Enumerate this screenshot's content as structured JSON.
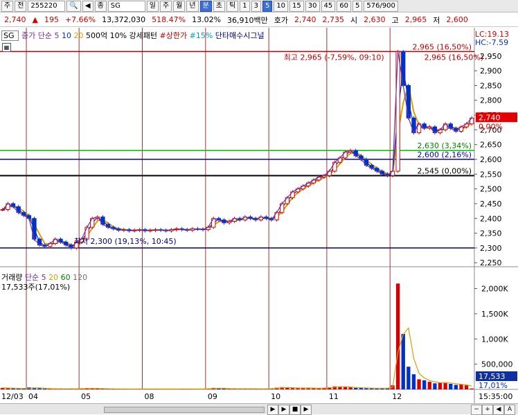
{
  "toolbar": {
    "items": [
      "주",
      "전",
      "255220",
      "🔍",
      "◀",
      "종",
      "SG",
      "일",
      "주",
      "월",
      "년",
      "분",
      "초",
      "틱",
      "1",
      "3",
      "5",
      "10",
      "15",
      "30",
      "45",
      "60",
      "5",
      "576/900"
    ]
  },
  "quote": {
    "price": "2,740",
    "arrow": "▲",
    "change": "195",
    "change_pct": "+7.66%",
    "volume": "13,372,030",
    "vol_ratio": "518.47%",
    "turnover": "13.02%",
    "amount": "36,910백만",
    "label_ask": "호가",
    "ask1": "2,740",
    "ask2": "2,735",
    "label_open": "시",
    "open": "2,630",
    "label_high": "고",
    "high": "2,965",
    "label_low": "저",
    "low": "2,600"
  },
  "price_legend": {
    "tag": "SG",
    "items": [
      {
        "text": "종가 단순",
        "color": "#7030a0"
      },
      {
        "text": "5",
        "color": "#7030a0"
      },
      {
        "text": "10",
        "color": "#0030c8"
      },
      {
        "text": "20",
        "color": "#d8a000"
      },
      {
        "text": "500억 10% 강세패턴",
        "color": "#000000"
      },
      {
        "text": "#상한가",
        "color": "#c00000"
      },
      {
        "text": "#15%",
        "color": "#00a0c0"
      },
      {
        "text": "단타매수시그널",
        "color": "#000080"
      }
    ]
  },
  "volume_legend": {
    "items": [
      {
        "text": "거래량",
        "color": "#000000"
      },
      {
        "text": "단순",
        "color": "#7030a0"
      },
      {
        "text": "5",
        "color": "#7030a0"
      },
      {
        "text": "20",
        "color": "#d8a000"
      },
      {
        "text": "60",
        "color": "#008000"
      },
      {
        "text": "120",
        "color": "#707070"
      }
    ],
    "current": "17,533주(17,01%)"
  },
  "corner": {
    "lc": "LC:19.13",
    "hc": "HC:-7.59"
  },
  "chart_data": {
    "type": "candlestick",
    "price_axis": {
      "ylim": [
        2220,
        2980
      ],
      "ticks": [
        2250,
        2300,
        2350,
        2400,
        2450,
        2500,
        2550,
        2600,
        2650,
        2700,
        2750,
        2800,
        2850,
        2900,
        2950
      ],
      "tick_labels": [
        "2,250",
        "2,300",
        "2,350",
        "2,400",
        "2,450",
        "2,500",
        "2,550",
        "2,600",
        "2,650",
        "2,700",
        "2,750",
        "2,800",
        "2,850",
        "2,900",
        "2,950"
      ]
    },
    "volume_axis": {
      "ylim": [
        0,
        2200000
      ],
      "ticks": [
        500000,
        1000000,
        1500000,
        2000000
      ],
      "tick_labels": [
        "500,000",
        "1,000K",
        "1,500K",
        "2,000K"
      ]
    },
    "x_axis": {
      "labels": [
        "12/03",
        "04",
        "05",
        "08",
        "09",
        "10",
        "11",
        "12"
      ],
      "time_label": "15:35:00"
    },
    "day_separators": [
      "04",
      "05",
      "08",
      "09",
      "10",
      "11",
      "12"
    ],
    "hlines": [
      {
        "value": 2965,
        "color": "#c00000",
        "label": "2,965 (16,50%)"
      },
      {
        "value": 2630,
        "color": "#00c000",
        "label": "2,630 (3,34%)"
      },
      {
        "value": 2600,
        "color": "#0000c8",
        "label": "2,600 (2,16%)"
      },
      {
        "value": 2545,
        "color": "#000000",
        "label": "2,545 (0,00%)"
      },
      {
        "value": 2300,
        "color": "#000080",
        "label": ""
      }
    ],
    "annotations": {
      "high": "최고 2,965 (-7,59%, 09:10)",
      "low": "최저 2,300 (19,13%, 10:45)",
      "current_price": "2,740",
      "current_pct": "0,00%",
      "current_volume": "17,533",
      "current_volume_pct": "17,01%"
    },
    "close_path": [
      {
        "day": "12/03",
        "values": [
          2430,
          2450,
          2440,
          2420,
          2410
        ]
      },
      {
        "day": "04",
        "values": [
          2400,
          2330,
          2310,
          2305,
          2315,
          2330,
          2320,
          2310,
          2300,
          2320
        ]
      },
      {
        "day": "05",
        "values": [
          2330,
          2370,
          2400,
          2405,
          2380,
          2370,
          2365,
          2360,
          2362,
          2358,
          2360,
          2362
        ]
      },
      {
        "day": "08",
        "values": [
          2358,
          2360,
          2362,
          2360,
          2358,
          2362,
          2365,
          2362,
          2360,
          2365,
          2364,
          2362
        ]
      },
      {
        "day": "09",
        "values": [
          2370,
          2400,
          2395,
          2385,
          2390,
          2400,
          2395,
          2405,
          2400,
          2395,
          2405,
          2400
        ]
      },
      {
        "day": "10",
        "values": [
          2395,
          2420,
          2450,
          2470,
          2490,
          2500,
          2510,
          2520,
          2530,
          2540,
          2545
        ]
      },
      {
        "day": "11",
        "values": [
          2560,
          2590,
          2605,
          2625,
          2630,
          2612,
          2600,
          2580,
          2570,
          2560,
          2550,
          2545
        ]
      },
      {
        "day": "12",
        "values": [
          2560,
          2965,
          2850,
          2740,
          2690,
          2720,
          2705,
          2710,
          2690,
          2700,
          2720,
          2705,
          2695,
          2710,
          2720,
          2740
        ]
      }
    ],
    "volume_profile": [
      {
        "day": "12/03",
        "values": [
          30000,
          25000,
          20000,
          18000,
          15000
        ]
      },
      {
        "day": "04",
        "values": [
          40000,
          30000,
          20000,
          15000,
          12000,
          10000,
          15000,
          10000,
          12000,
          10000
        ]
      },
      {
        "day": "05",
        "values": [
          20000,
          25000,
          18000,
          15000,
          12000,
          10000,
          10000,
          8000,
          9000,
          8000,
          9000,
          10000
        ]
      },
      {
        "day": "08",
        "values": [
          10000,
          8000,
          9000,
          8000,
          7000,
          9000,
          8000,
          10000,
          9000,
          8000,
          8000,
          9000
        ]
      },
      {
        "day": "09",
        "values": [
          15000,
          30000,
          20000,
          15000,
          12000,
          15000,
          12000,
          14000,
          12000,
          10000,
          12000,
          10000
        ]
      },
      {
        "day": "10",
        "values": [
          20000,
          35000,
          45000,
          30000,
          25000,
          28000,
          30000,
          25000,
          22000,
          25000,
          30000
        ]
      },
      {
        "day": "11",
        "values": [
          40000,
          60000,
          55000,
          45000,
          40000,
          30000,
          28000,
          25000,
          22000,
          20000,
          22000,
          25000
        ]
      },
      {
        "day": "12",
        "values": [
          80000,
          2100000,
          1100000,
          450000,
          300000,
          200000,
          180000,
          150000,
          120000,
          130000,
          140000,
          110000,
          90000,
          100000,
          80000,
          17533
        ]
      }
    ]
  }
}
